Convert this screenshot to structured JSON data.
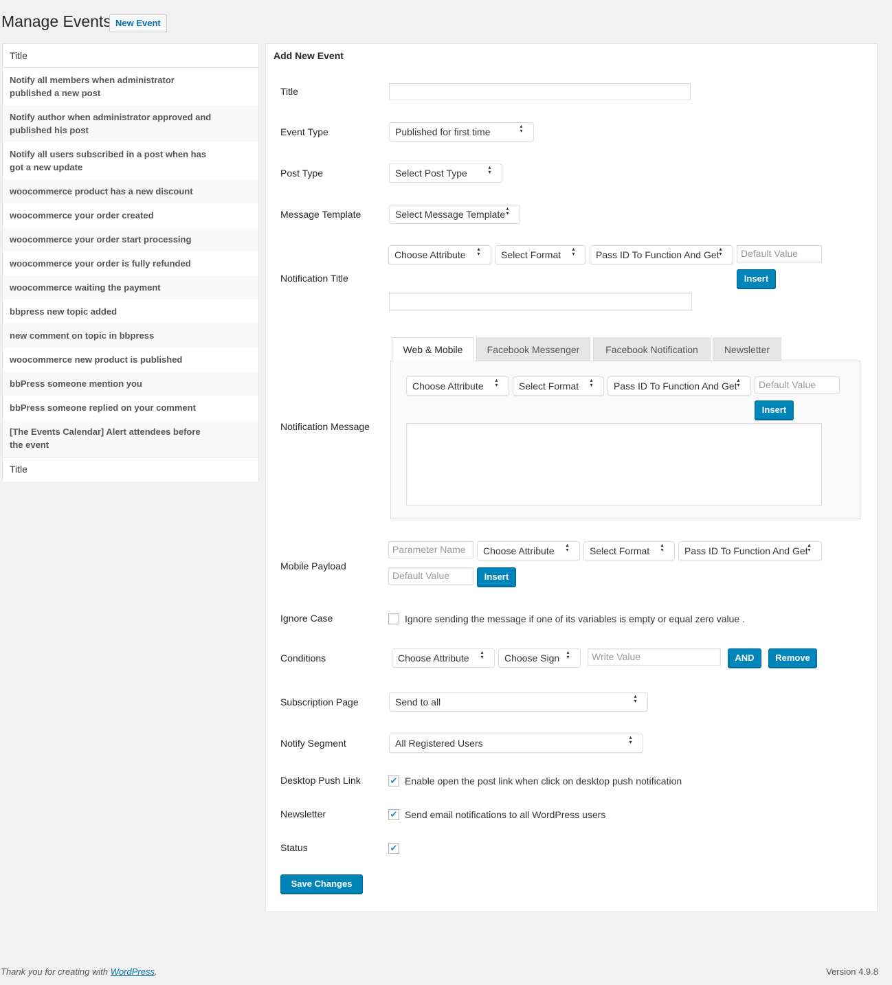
{
  "header": {
    "title": "Manage Events",
    "new_button": "New Event"
  },
  "events_list": {
    "header": "Title",
    "footer": "Title",
    "items": [
      "Notify all members when administrator published a new post",
      "Notify author when administrator approved and published his post",
      "Notify all users subscribed in a post when has got a new update",
      "woocommerce product has a new discount",
      "woocommerce your order created",
      "woocommerce your order start processing",
      "woocommerce your order is fully refunded",
      "woocommerce waiting the payment",
      "bbpress new topic added",
      "new comment on topic in bbpress",
      "woocommerce new product is published",
      "bbPress someone mention you",
      "bbPress someone replied on your comment",
      "[The Events Calendar] Alert attendees before the event"
    ]
  },
  "form": {
    "heading": "Add New Event",
    "labels": {
      "title": "Title",
      "event_type": "Event Type",
      "post_type": "Post Type",
      "message_template": "Message Template",
      "notification_title": "Notification Title",
      "notification_message": "Notification Message",
      "mobile_payload": "Mobile Payload",
      "ignore_case": "Ignore Case",
      "conditions": "Conditions",
      "subscription_page": "Subscription Page",
      "notify_segment": "Notify Segment",
      "desktop_push_link": "Desktop Push Link",
      "newsletter": "Newsletter",
      "status": "Status"
    },
    "title_value": "",
    "event_type": "Published for first time",
    "post_type": "Select Post Type",
    "message_template": "Select Message Template",
    "choose_attribute": "Choose Attribute",
    "select_format": "Select Format",
    "pass_id": "Pass ID To Function And Get",
    "default_value_placeholder": "Default Value",
    "insert": "Insert",
    "tabs": [
      "Web & Mobile",
      "Facebook Messenger",
      "Facebook Notification",
      "Newsletter"
    ],
    "parameter_name_placeholder": "Parameter Name",
    "ignore_case_text": "Ignore sending the message if one of its variables is empty or equal zero value .",
    "ignore_case_checked": false,
    "choose_sign": "Choose Sign",
    "write_value_placeholder": "Write Value",
    "and": "AND",
    "remove": "Remove",
    "subscription_page": "Send to all",
    "notify_segment": "All Registered Users",
    "desktop_push_text": "Enable open the post link when click on desktop push notification",
    "desktop_push_checked": true,
    "newsletter_text": "Send email notifications to all WordPress users",
    "newsletter_checked": true,
    "status_checked": true,
    "save": "Save Changes"
  },
  "footer": {
    "thanks": "Thank you for creating with ",
    "link": "WordPress",
    "period": ".",
    "version": "Version 4.9.8"
  }
}
